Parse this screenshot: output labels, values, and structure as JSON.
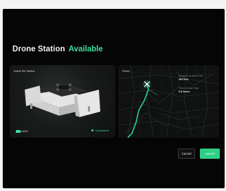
{
  "dialog": {
    "title": "Drone Station",
    "status": "Available"
  },
  "station_panel": {
    "label": "Inside the Station",
    "battery": "85%",
    "connection": "Connected"
  },
  "route_panel": {
    "label": "Route",
    "distance_label": "Distance to Next Point",
    "distance_value": "18.0 Km",
    "time_label": "Time to Next Point",
    "time_value": "0.5 Hours"
  },
  "actions": {
    "cancel": "Cancel",
    "launch": "Launch"
  },
  "colors": {
    "accent": "#3ee0a0",
    "background": "#050505"
  }
}
